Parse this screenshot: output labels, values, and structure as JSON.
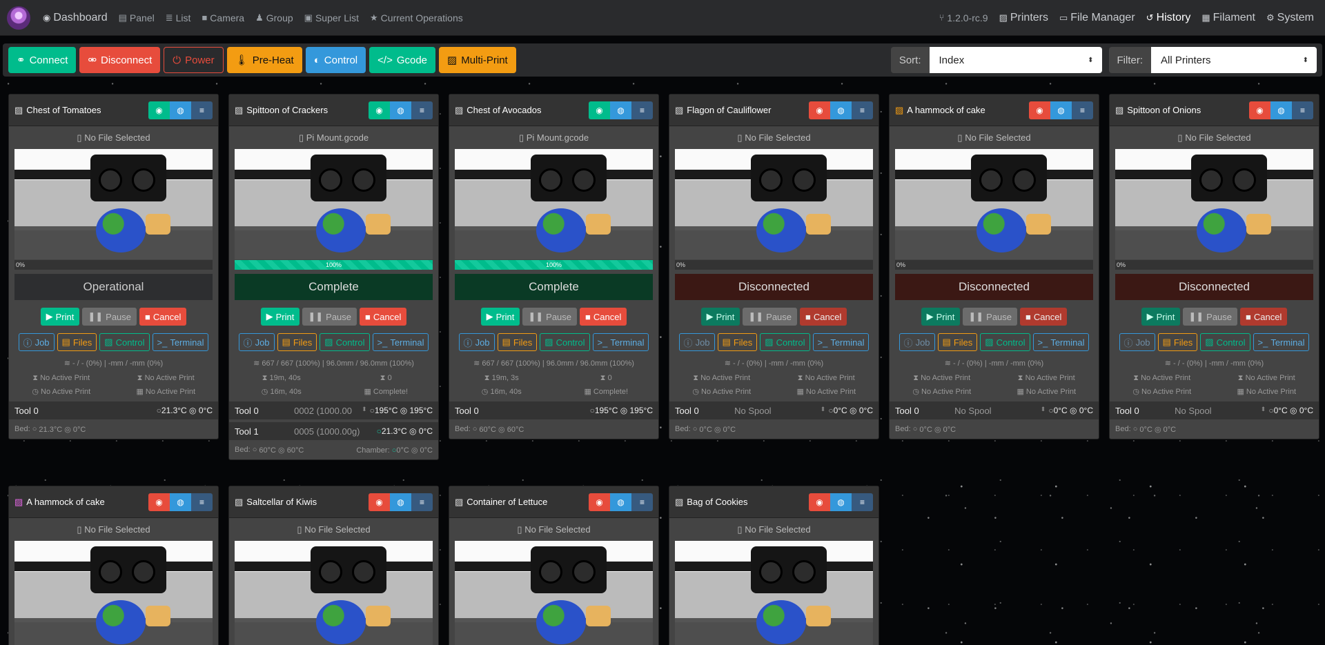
{
  "nav": {
    "items": [
      {
        "icon": "◉",
        "label": "Dashboard",
        "icon_name": "dashboard-icon"
      },
      {
        "icon": "▤",
        "label": "Panel",
        "icon_name": "panel-icon"
      },
      {
        "icon": "≣",
        "label": "List",
        "icon_name": "list-icon"
      },
      {
        "icon": "■",
        "label": "Camera",
        "icon_name": "camera-icon"
      },
      {
        "icon": "♟",
        "label": "Group",
        "icon_name": "group-icon"
      },
      {
        "icon": "▣",
        "label": "Super List",
        "icon_name": "super-list-icon"
      },
      {
        "icon": "★",
        "label": "Current Operations",
        "icon_name": "star-icon"
      }
    ],
    "version": "1.2.0-rc.9",
    "right_items": [
      {
        "icon": "▨",
        "label": "Printers",
        "icon_name": "printer-icon"
      },
      {
        "icon": "▭",
        "label": "File Manager",
        "icon_name": "folder-icon"
      },
      {
        "icon": "↺",
        "label": "History",
        "icon_name": "history-icon"
      },
      {
        "icon": "▦",
        "label": "Filament",
        "icon_name": "filament-icon"
      },
      {
        "icon": "⚙",
        "label": "System",
        "icon_name": "gear-icon"
      }
    ]
  },
  "toolbar": {
    "connect": "Connect",
    "disconnect": "Disconnect",
    "power": "Power",
    "preheat": "Pre-Heat",
    "control": "Control",
    "gcode": "Gcode",
    "multiprint": "Multi-Print",
    "sort_label": "Sort:",
    "sort_value": "Index",
    "filter_label": "Filter:",
    "filter_value": "All Printers"
  },
  "colors": {
    "green": "#00bc8c",
    "red": "#e74c3c",
    "orange": "#f39c12",
    "blue": "#3498db"
  },
  "labels": {
    "print": "Print",
    "pause": "Pause",
    "cancel": "Cancel",
    "job": "Job",
    "files": "Files",
    "control": "Control",
    "terminal": "Terminal",
    "bed": "Bed:",
    "chamber": "Chamber:"
  },
  "printers": [
    {
      "name": "Chest of Tomatoes",
      "icon_color": "#dddddd",
      "connected": true,
      "file": "No File Selected",
      "progress": "0%",
      "progress_value": 0,
      "state": "Operational",
      "state_class": "st-op",
      "stats": "- / - (0%) | -mm / -mm (0%)",
      "t1": "No Active Print",
      "t2": "No Active Print",
      "t3": "No Active Print",
      "t4": "No Active Print",
      "tool": "Tool 0",
      "spool": "",
      "temp": "21.3°C ◎ 0°C",
      "bed": "21.3°C ◎ 0°C",
      "dim": false
    },
    {
      "name": "Spittoon of Crackers",
      "icon_color": "#dddddd",
      "connected": true,
      "file": "Pi Mount.gcode",
      "progress": "100%",
      "progress_value": 100,
      "state": "Complete",
      "state_class": "st-co",
      "stats": "667 / 667 (100%) | 96.0mm / 96.0mm (100%)",
      "t1": "19m, 40s",
      "t2": "0",
      "t3": "16m, 40s",
      "t4": "Complete!",
      "tool": "Tool 0",
      "spool": "0002 (1000.00",
      "temp": "195°C ◎ 195°C",
      "tool1": "Tool 1",
      "spool1": "0005 (1000.00g)",
      "temp1": "21.3°C ◎ 0°C",
      "bed": "60°C ◎ 60°C",
      "chamber": "0°C ◎ 0°C",
      "dim": false
    },
    {
      "name": "Chest of Avocados",
      "icon_color": "#dddddd",
      "connected": true,
      "file": "Pi Mount.gcode",
      "progress": "100%",
      "progress_value": 100,
      "state": "Complete",
      "state_class": "st-co",
      "stats": "667 / 667 (100%) | 96.0mm / 96.0mm (100%)",
      "t1": "19m, 3s",
      "t2": "0",
      "t3": "16m, 40s",
      "t4": "Complete!",
      "tool": "Tool 0",
      "spool": "",
      "temp": "195°C ◎ 195°C",
      "bed": "60°C ◎ 60°C",
      "dim": false
    },
    {
      "name": "Flagon of Cauliflower",
      "icon_color": "#dddddd",
      "connected": false,
      "file": "No File Selected",
      "progress": "0%",
      "progress_value": 0,
      "state": "Disconnected",
      "state_class": "st-dc",
      "stats": "- / - (0%) | -mm / -mm (0%)",
      "t1": "No Active Print",
      "t2": "No Active Print",
      "t3": "No Active Print",
      "t4": "No Active Print",
      "tool": "Tool 0",
      "spool": "No Spool",
      "temp": "0°C ◎ 0°C",
      "bed": "0°C ◎ 0°C",
      "dim": true
    },
    {
      "name": "A hammock of cake",
      "icon_color": "#f39c12",
      "connected": false,
      "file": "No File Selected",
      "progress": "0%",
      "progress_value": 0,
      "state": "Disconnected",
      "state_class": "st-dc",
      "stats": "- / - (0%) | -mm / -mm (0%)",
      "t1": "No Active Print",
      "t2": "No Active Print",
      "t3": "No Active Print",
      "t4": "No Active Print",
      "tool": "Tool 0",
      "spool": "No Spool",
      "temp": "0°C ◎ 0°C",
      "bed": "0°C ◎ 0°C",
      "dim": true
    },
    {
      "name": "Spittoon of Onions",
      "icon_color": "#dddddd",
      "connected": false,
      "file": "No File Selected",
      "progress": "0%",
      "progress_value": 0,
      "state": "Disconnected",
      "state_class": "st-dc",
      "stats": "- / - (0%) | -mm / -mm (0%)",
      "t1": "No Active Print",
      "t2": "No Active Print",
      "t3": "No Active Print",
      "t4": "No Active Print",
      "tool": "Tool 0",
      "spool": "No Spool",
      "temp": "0°C ◎ 0°C",
      "bed": "0°C ◎ 0°C",
      "dim": true
    },
    {
      "name": "A hammock of cake",
      "icon_color": "#e066e0",
      "connected": false,
      "file": "No File Selected"
    },
    {
      "name": "Saltcellar of Kiwis",
      "icon_color": "#dddddd",
      "connected": false,
      "file": "No File Selected"
    },
    {
      "name": "Container of Lettuce",
      "icon_color": "#dddddd",
      "connected": false,
      "file": "No File Selected"
    },
    {
      "name": "Bag of Cookies",
      "icon_color": "#dddddd",
      "connected": false,
      "file": "No File Selected"
    }
  ]
}
